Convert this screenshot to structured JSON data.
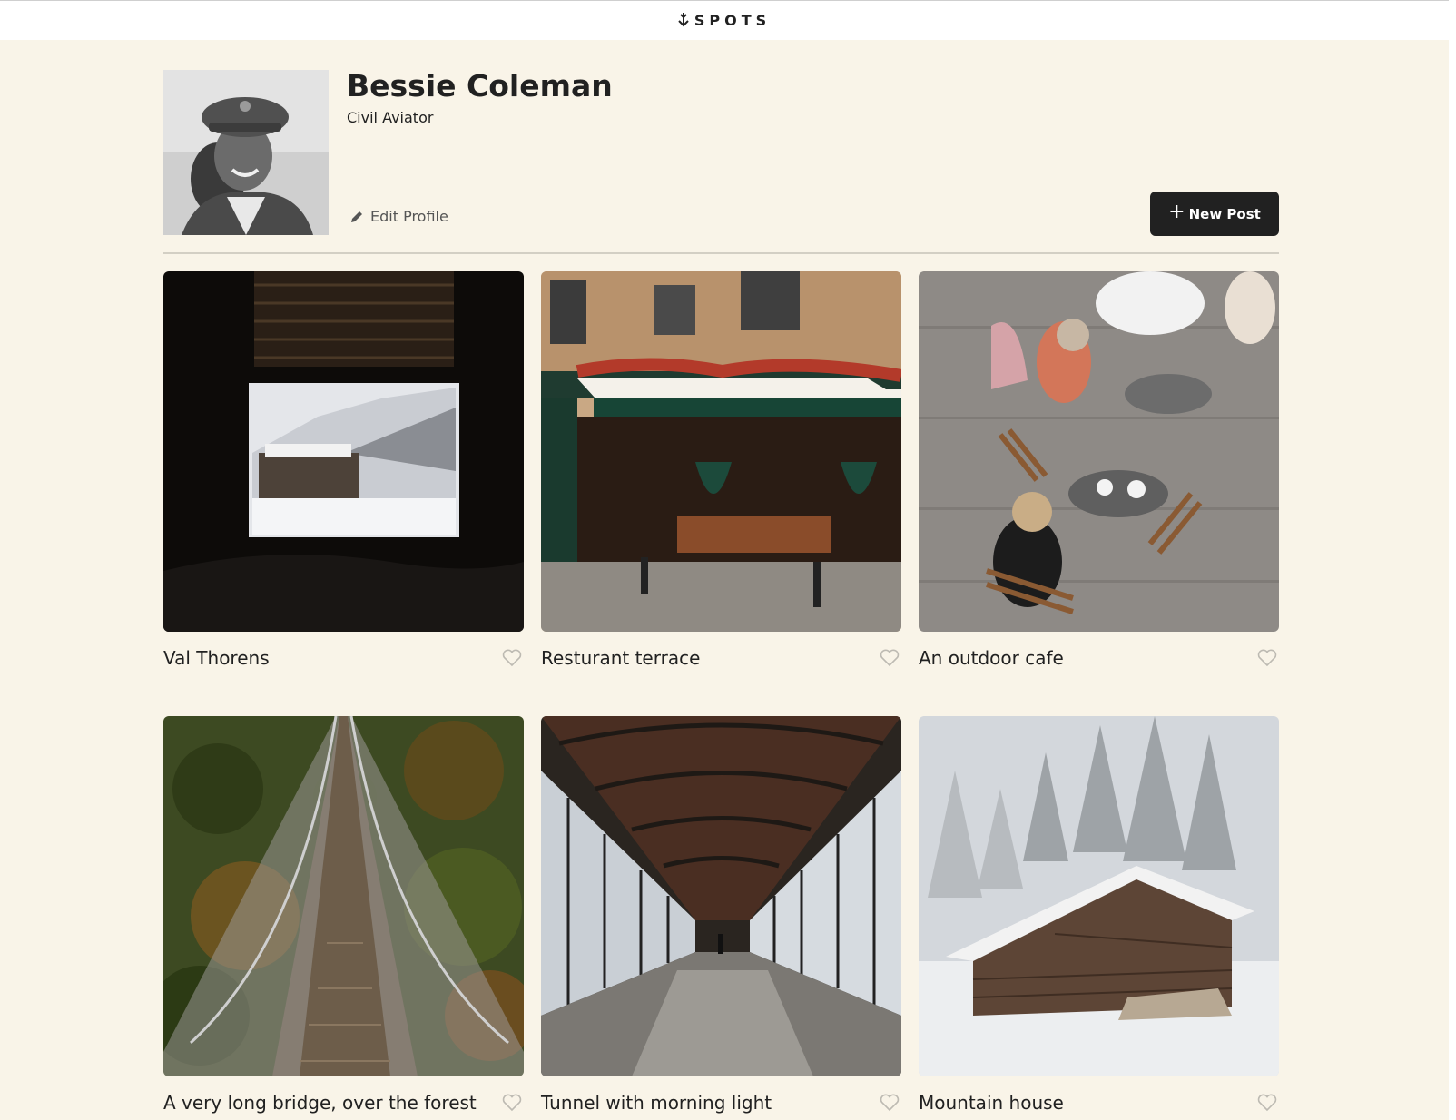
{
  "header": {
    "logo_text": "SPOTS"
  },
  "profile": {
    "name": "Bessie Coleman",
    "description": "Civil Aviator",
    "edit_label": "Edit Profile",
    "new_post_label": "New Post",
    "new_post_icon": "+"
  },
  "cards": [
    {
      "title": "Val Thorens",
      "icon": "heart-outline"
    },
    {
      "title": "Resturant terrace",
      "icon": "heart-outline"
    },
    {
      "title": "An outdoor cafe",
      "icon": "heart-outline"
    },
    {
      "title": "A very long bridge, over the forest",
      "icon": "heart-outline"
    },
    {
      "title": "Tunnel with morning light",
      "icon": "heart-outline"
    },
    {
      "title": "Mountain house",
      "icon": "heart-outline"
    }
  ],
  "colors": {
    "page_background": "#f9f4e8",
    "header_background": "#ffffff",
    "primary_button": "#212121",
    "text": "#212121"
  }
}
